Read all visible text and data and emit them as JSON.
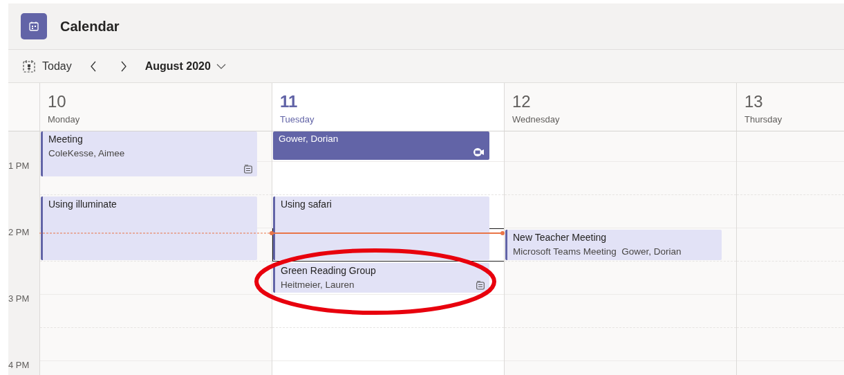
{
  "app": {
    "title": "Calendar"
  },
  "toolbar": {
    "today": "Today",
    "month": "August 2020"
  },
  "times": [
    "1 PM",
    "2 PM",
    "3 PM",
    "4 PM"
  ],
  "days": [
    {
      "number": "10",
      "name": "Monday",
      "selected": false,
      "events": [
        {
          "title": "Meeting",
          "detail": "ColeKesse, Aimee",
          "kind": "note"
        },
        {
          "title": "Using illuminate",
          "kind": "plain"
        }
      ]
    },
    {
      "number": "11",
      "name": "Tuesday",
      "selected": true,
      "events": [
        {
          "detail": "Gower, Dorian",
          "kind": "online"
        },
        {
          "title": "Using safari",
          "kind": "plain"
        },
        {
          "title": "Green Reading Group",
          "detail": "Heitmeier, Lauren",
          "kind": "note"
        }
      ]
    },
    {
      "number": "12",
      "name": "Wednesday",
      "selected": false,
      "events": [
        {
          "title": "New Teacher Meeting",
          "detail": "Microsoft Teams Meeting  Gower, Dorian",
          "kind": "plain"
        }
      ]
    },
    {
      "number": "13",
      "name": "Thursday",
      "selected": false
    }
  ]
}
